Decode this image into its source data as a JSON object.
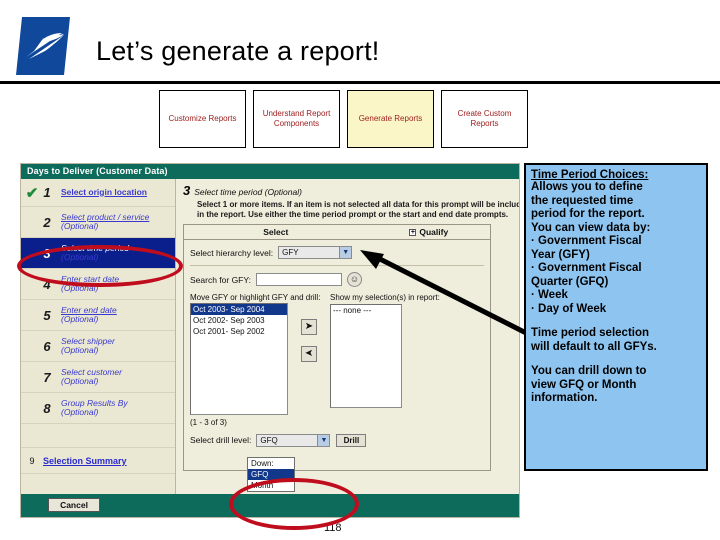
{
  "slide": {
    "title": "Let’s generate a report!",
    "logo_icon": "usps-eagle-logo",
    "page_number": "118"
  },
  "nav_boxes": [
    {
      "label": "Customize Reports",
      "active": false
    },
    {
      "label": "Understand Report Components",
      "active": false
    },
    {
      "label": "Generate Reports",
      "active": true
    },
    {
      "label": "Create Custom Reports",
      "active": false
    }
  ],
  "app": {
    "titlebar": "Days to Deliver (Customer Data)",
    "steps": [
      {
        "num": "1",
        "label": "Select origin location",
        "optional": "",
        "state": "done",
        "check": "✔"
      },
      {
        "num": "2",
        "label": "Select product / service",
        "optional": "(Optional)",
        "state": "normal",
        "check": ""
      },
      {
        "num": "3",
        "label": "Select time period",
        "optional": "(Optional)",
        "state": "selected",
        "check": ""
      },
      {
        "num": "4",
        "label": "Enter start date",
        "optional": "(Optional)",
        "state": "normal",
        "check": ""
      },
      {
        "num": "5",
        "label": "Enter end date",
        "optional": "(Optional)",
        "state": "normal",
        "check": ""
      },
      {
        "num": "6",
        "label": "Select shipper",
        "optional": "(Optional)",
        "state": "normal",
        "check": ""
      },
      {
        "num": "7",
        "label": "Select customer",
        "optional": "(Optional)",
        "state": "normal",
        "check": ""
      },
      {
        "num": "8",
        "label": "Group Results By",
        "optional": "(Optional)",
        "state": "normal",
        "check": ""
      }
    ],
    "summary": {
      "glyph": "9",
      "label": "Selection Summary"
    },
    "content": {
      "step_num": "3",
      "step_title": "Select time period (Optional)",
      "instructions": "Select 1 or more items. If an item is not selected all data for this prompt will be included in the report. Use either the time period prompt or the start and end date prompts.",
      "tabs": {
        "select": "Select",
        "qualify": "Qualify",
        "qualify_icon": "plus-box-icon"
      },
      "hierarchy_label": "Select hierarchy level:",
      "hierarchy_value": "GFY",
      "search_label": "Search for GFY:",
      "search_value": "",
      "search_icon": "search-person-icon",
      "available_label": "Move GFY or highlight GFY and drill:",
      "available_items": [
        {
          "text": "Oct 2003- Sep 2004",
          "selected": true
        },
        {
          "text": "Oct 2002- Sep 2003",
          "selected": false
        },
        {
          "text": "Oct 2001- Sep 2002",
          "selected": false
        }
      ],
      "move_right_icon": "arrow-right-icon",
      "move_left_icon": "arrow-left-icon",
      "selected_label": "Show my selection(s) in report:",
      "selected_items": [
        "--- none ---"
      ],
      "count_text": "(1 - 3 of 3)",
      "drill_label": "Select drill level:",
      "drill_value": "GFQ",
      "drill_button": "Drill",
      "drill_options": [
        {
          "text": "Down:",
          "selected": false
        },
        {
          "text": "GFQ",
          "selected": true
        },
        {
          "text": "Month",
          "selected": false
        }
      ]
    },
    "footer": {
      "cancel": "Cancel"
    }
  },
  "callout": {
    "title": "Time Period Choices:",
    "paragraph1": [
      "Allows you to define",
      "the requested time",
      "period for the report.",
      "You can view data by:",
      "· Government Fiscal",
      "Year (GFY)",
      "· Government Fiscal",
      "Quarter (GFQ)",
      "· Week",
      "· Day of Week"
    ],
    "paragraph2": [
      "Time period selection",
      "will default to all GFYs."
    ],
    "paragraph3": [
      "You can drill down to",
      "view GFQ or Month",
      "information."
    ],
    "bg_color": "#8ec5f0"
  },
  "annotations": {
    "ellipse_color": "#c00d1e",
    "arrow_icon": "pointer-arrow-icon"
  }
}
